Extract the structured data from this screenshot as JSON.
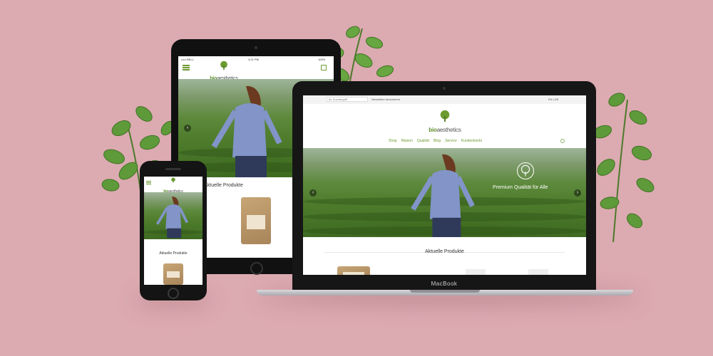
{
  "brand": {
    "logo_bold": "bio",
    "logo_light": "aesthetics"
  },
  "colors": {
    "background": "#dcaab1",
    "accent_green": "#6c9b30",
    "device_black": "#111111"
  },
  "tablet": {
    "status_carrier": "••••• BELL",
    "status_time": "4:21 PM",
    "status_battery": "100%",
    "section_title": "Aktuelle Produkte",
    "menu_icon": "hamburger-icon",
    "cart_icon": "bag-icon"
  },
  "phone": {
    "section_title": "Aktuelle Produkte"
  },
  "laptop": {
    "search_placeholder": "Ihr Suchbegriff",
    "newsletter_link": "Newsletter abonnieren",
    "language_switch": "EN | DE",
    "nav": [
      "Shop",
      "Maison",
      "Qualität",
      "Blog",
      "Service",
      "Kundenkonto"
    ],
    "hero_text": "Premium Qualität für Alle",
    "section_title": "Aktuelle Produkte",
    "brand_name": "MacBook"
  }
}
